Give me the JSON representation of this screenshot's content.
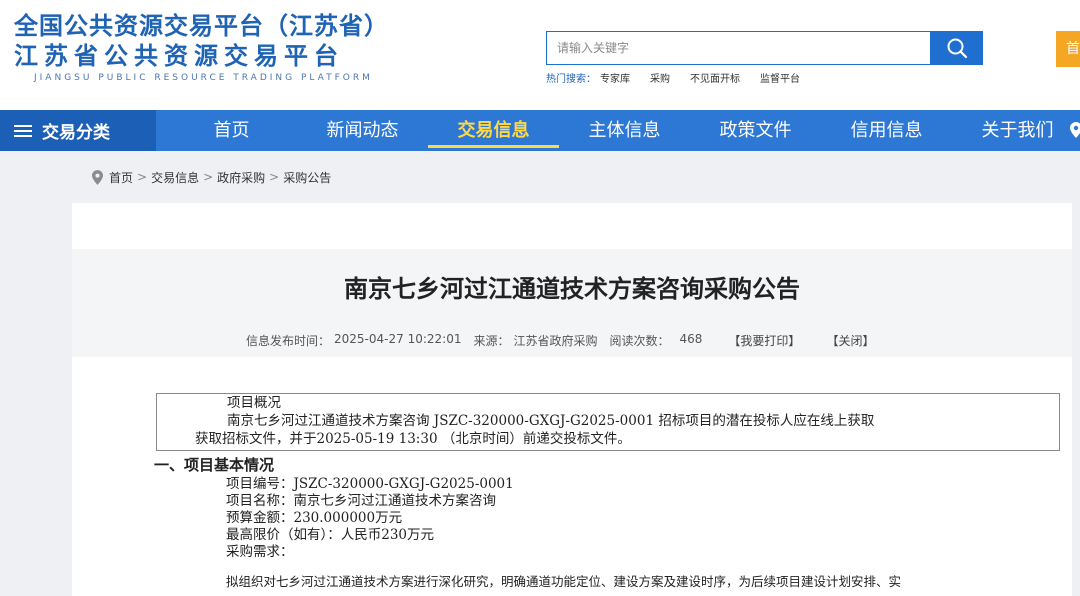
{
  "header": {
    "logo_line1": "全国公共资源交易平台（江苏省）",
    "logo_line2": "江苏省公共资源交易平台",
    "logo_line3": "JIANGSU PUBLIC RESOURCE TRADING PLATFORM",
    "search_placeholder": "请输入关键字",
    "hot_label": "热门搜索：",
    "hot_items": [
      "专家库",
      "采购",
      "不见面开标",
      "监督平台"
    ],
    "orange_btn_label": "首"
  },
  "nav": {
    "category_label": "交易分类",
    "items": [
      "首页",
      "新闻动态",
      "交易信息",
      "主体信息",
      "政策文件",
      "信用信息",
      "关于我们"
    ],
    "active_index": 2
  },
  "breadcrumb": [
    "首页",
    "交易信息",
    "政府采购",
    "采购公告"
  ],
  "article": {
    "title": "南京七乡河过江通道技术方案咨询采购公告",
    "meta": {
      "publish_label": "信息发布时间：",
      "publish_time": "2025-04-27 10:22:01",
      "source_label": "来源：",
      "source": "江苏省政府采购",
      "views_label": "阅读次数：",
      "views": "468",
      "print_label": "【我要打印】",
      "close_label": "【关闭】"
    },
    "overview": {
      "title": "项目概况",
      "line1": "南京七乡河过江通道技术方案咨询 JSZC-320000-GXGJ-G2025-0001 招标项目的潜在投标人应在线上获取",
      "line2": "获取招标文件，并于2025-05-19 13:30 （北京时间）前递交投标文件。"
    },
    "section1_title": "一、项目基本情况",
    "details": [
      "项目编号：JSZC-320000-GXGJ-G2025-0001",
      "项目名称：南京七乡河过江通道技术方案咨询",
      "预算金额：230.000000万元",
      "最高限价（如有）：人民币230万元",
      "采购需求："
    ],
    "desc": "拟组织对七乡河过江通道技术方案进行深化研究，明确通道功能定位、建设方案及建设时序，为后续项目建设计划安排、实"
  }
}
